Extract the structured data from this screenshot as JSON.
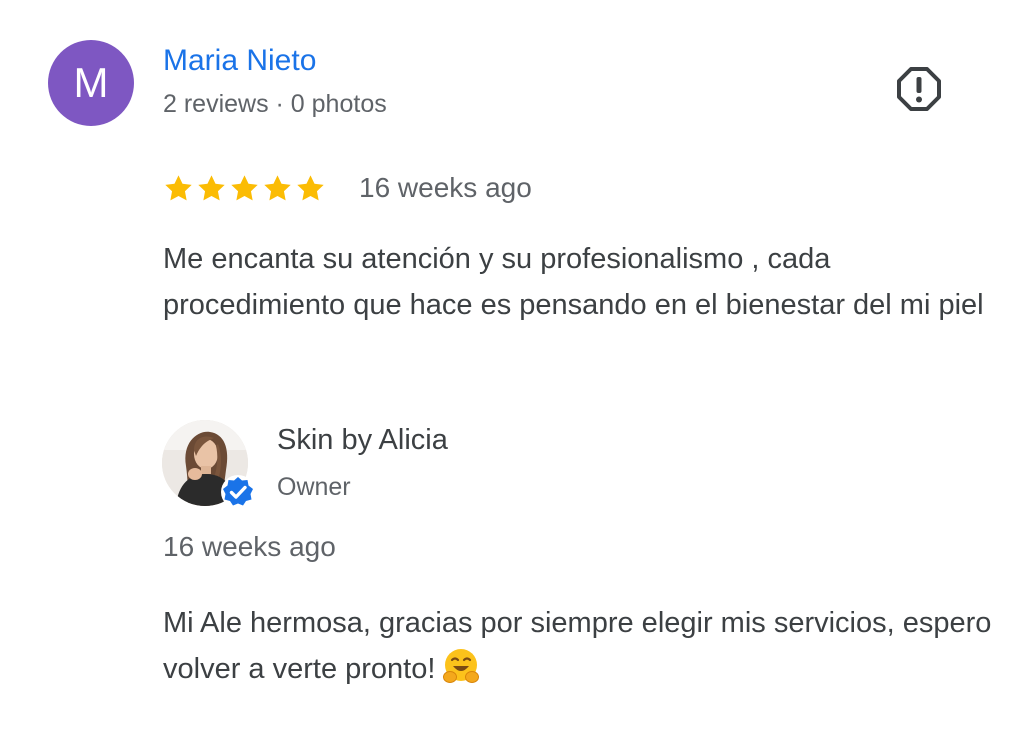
{
  "review": {
    "avatar_letter": "M",
    "avatar_color": "#7e57c2",
    "reviewer_name": "Maria Nieto",
    "reviewer_meta": "2 reviews · 0 photos",
    "rating": 5,
    "rating_max": 5,
    "star_color": "#fbbc04",
    "date": "16 weeks ago",
    "text": "Me encanta su atención y su profesionalismo , cada procedimiento que hace es pensando en el bienestar del mi piel",
    "flag_icon": "report-flag-icon"
  },
  "owner_reply": {
    "owner_name": "Skin by Alicia",
    "owner_role": "Owner",
    "verified_icon": "verified-badge-icon",
    "date": "16 weeks ago",
    "text": "Mi Ale hermosa, gracias por siempre elegir mis servicios, espero volver a verte pronto!",
    "emoji_icon": "smiling-face-with-open-hands-emoji"
  },
  "colors": {
    "name_link": "#1a73e8",
    "secondary_text": "#5f6368",
    "body_text": "#3c4043",
    "verified_blue": "#1a73e8"
  }
}
